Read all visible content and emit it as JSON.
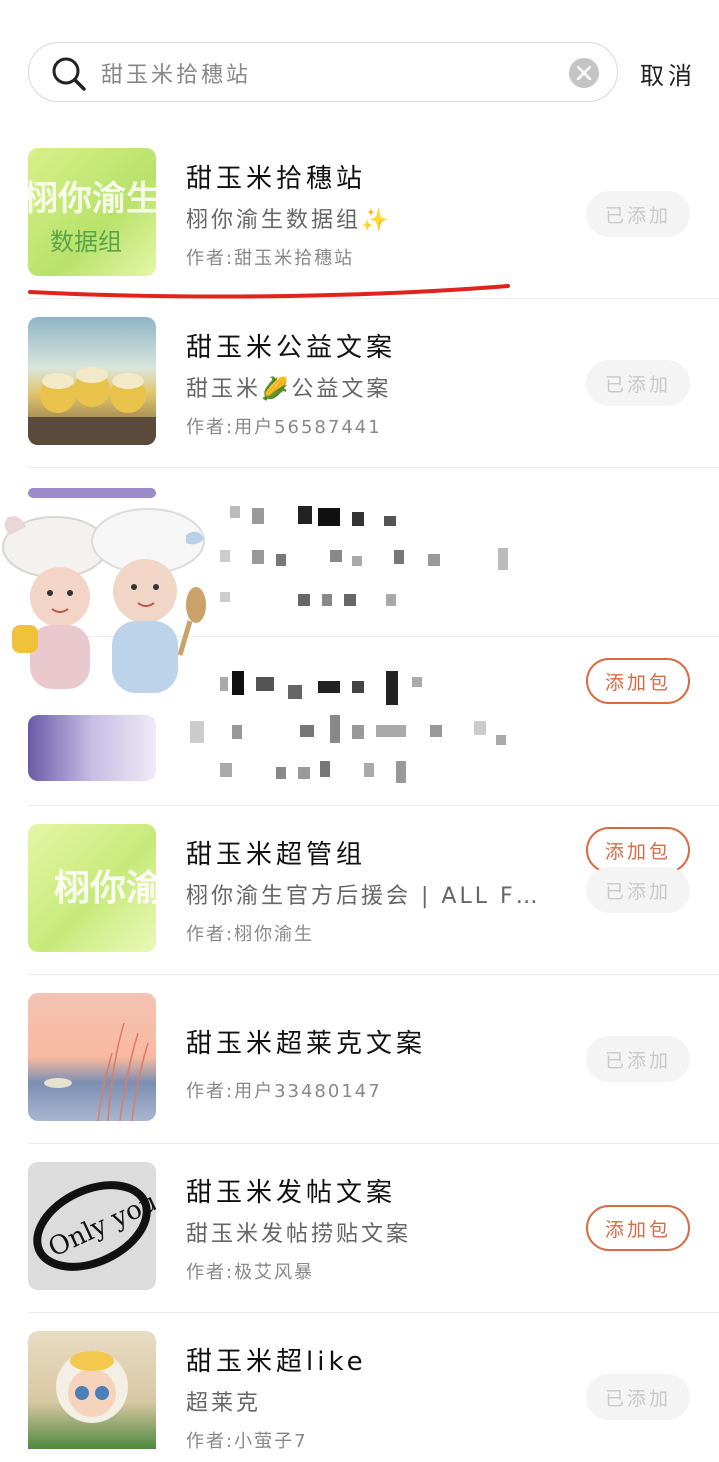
{
  "search": {
    "query": "甜玉米拾穗站",
    "cancel_label": "取消"
  },
  "results": [
    {
      "title": "甜玉米拾穗站",
      "desc": "栩你渝生数据组✨",
      "author": "作者:甜玉米拾穗站",
      "button": "已添加",
      "added": true,
      "thumb_text": "栩你渝生 数据组"
    },
    {
      "title": "甜玉米公益文案",
      "desc": "甜玉米🌽公益文案",
      "author": "作者:用户56587441",
      "button": "已添加",
      "added": true
    },
    {
      "title": "",
      "desc": "",
      "author": "",
      "button": "添加包",
      "added": false
    },
    {
      "title": "",
      "desc": "",
      "author": "",
      "button": "添加包",
      "added": false
    },
    {
      "title": "甜玉米超管组",
      "desc": "栩你渝生官方后援会 | ALL FO...",
      "author": "作者:栩你渝生",
      "button": "已添加",
      "added": true,
      "thumb_text": "栩你渝"
    },
    {
      "title": "甜玉米超莱克文案",
      "desc": "",
      "author": "作者:用户33480147",
      "button": "已添加",
      "added": true
    },
    {
      "title": "甜玉米发帖文案",
      "desc": "甜玉米发帖捞贴文案",
      "author": "作者:极艾风暴",
      "button": "添加包",
      "added": false,
      "thumb_text": "Only you"
    },
    {
      "title": "甜玉米超like",
      "desc": "超莱克",
      "author": "作者:小萤子7",
      "button": "已添加",
      "added": true
    }
  ],
  "colors": {
    "accent": "#d96a45",
    "annotation_red": "#e0231c",
    "added_bg": "#f4f4f4"
  },
  "icons": [
    "search-icon",
    "clear-icon"
  ]
}
